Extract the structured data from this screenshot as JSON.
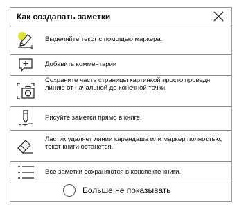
{
  "dialog": {
    "title": "Как создавать заметки",
    "items": [
      {
        "icon": "marker-icon",
        "text": "Выделяйте текст с помощью маркера."
      },
      {
        "icon": "comment-icon",
        "text": "Добавить комментарии"
      },
      {
        "icon": "screenshot-camera-icon",
        "text": "Сохраните часть страницы картинкой просто проведя линию от начальной до конечной точки."
      },
      {
        "icon": "pencil-icon",
        "text": "Рисуйте заметки прямо в книге."
      },
      {
        "icon": "eraser-icon",
        "text": "Ластик удаляет линии карандаша или маркер полностью, текст книги останется."
      },
      {
        "icon": "list-icon",
        "text": "Все заметки сохраняются в конспекте книги."
      }
    ],
    "footer": {
      "label": "Больше не показывать"
    },
    "colors": {
      "marker_highlight": "#d8e23a",
      "border": "#9a9a9a"
    }
  }
}
